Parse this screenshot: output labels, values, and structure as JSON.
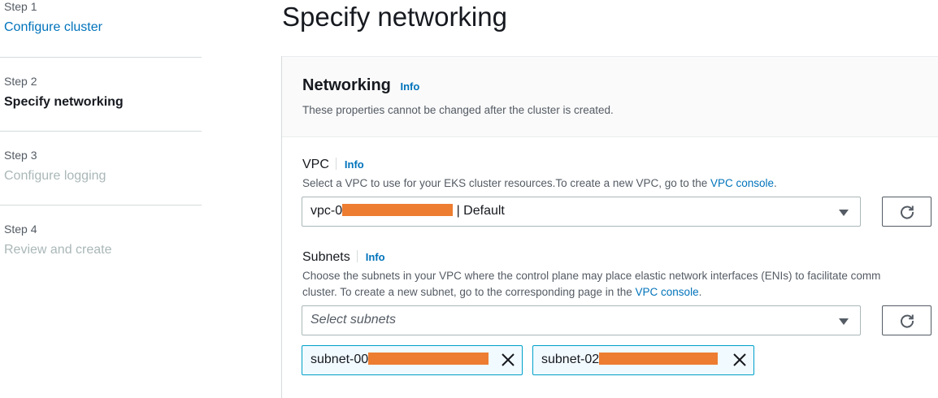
{
  "steps": [
    {
      "num": "Step 1",
      "title": "Configure cluster"
    },
    {
      "num": "Step 2",
      "title": "Specify networking"
    },
    {
      "num": "Step 3",
      "title": "Configure logging"
    },
    {
      "num": "Step 4",
      "title": "Review and create"
    }
  ],
  "page_title": "Specify networking",
  "panel": {
    "heading": "Networking",
    "info": "Info",
    "description": "These properties cannot be changed after the cluster is created."
  },
  "vpc": {
    "label": "VPC",
    "info": "Info",
    "desc_pre": "Select a VPC to use for your EKS cluster resources.To create a new VPC, go to the ",
    "desc_link": "VPC console",
    "desc_post": ".",
    "value_prefix": "vpc-0",
    "value_suffix": "| Default"
  },
  "subnets": {
    "label": "Subnets",
    "info": "Info",
    "desc_line1": "Choose the subnets in your VPC where the control plane may place elastic network interfaces (ENIs) to facilitate comm",
    "desc_line2_pre": "cluster. To create a new subnet, go to the corresponding page in the ",
    "desc_link": "VPC console",
    "desc_line2_post": ".",
    "placeholder": "Select subnets",
    "tokens": [
      {
        "prefix": "subnet-00"
      },
      {
        "prefix": "subnet-02"
      }
    ]
  },
  "colors": {
    "link": "#0073bb",
    "redaction": "#ed7d31",
    "token_border": "#00a1c9"
  },
  "icons": [
    "refresh-icon",
    "caret-down-icon",
    "close-icon"
  ]
}
